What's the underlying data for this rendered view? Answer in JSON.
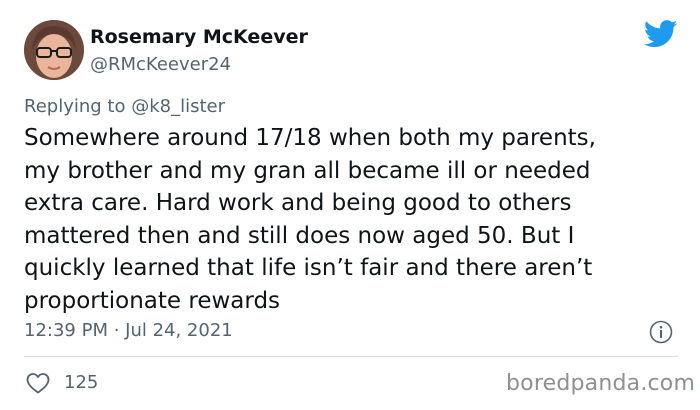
{
  "author": {
    "display_name": "Rosemary McKeever",
    "handle": "@RMcKeever24"
  },
  "reply": {
    "prefix": "Replying to ",
    "mention": "@k8_lister"
  },
  "tweet": {
    "text": "Somewhere around 17/18 when both my parents,\nmy brother and my gran all became ill or needed\nextra care. Hard work and being good to others\nmattered then and still does now aged 50. But I\nquickly learned that life isn’t fair and there aren’t\nproportionate rewards",
    "timestamp": "12:39 PM · Jul 24, 2021"
  },
  "engagement": {
    "likes": "125"
  },
  "watermark": "boredpanda.com",
  "colors": {
    "twitter_blue": "#1d9bf0",
    "secondary_text": "#536471",
    "primary_text": "#0f1419"
  },
  "icons": {
    "avatar": "avatar-photo",
    "logo": "twitter-bird-icon",
    "info": "info-icon",
    "like": "heart-icon"
  }
}
